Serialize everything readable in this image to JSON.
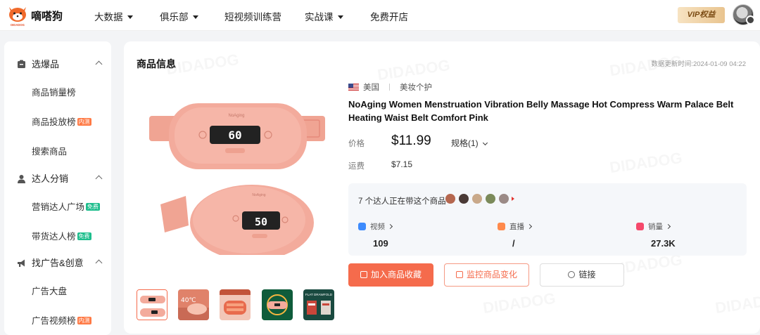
{
  "brand": {
    "name": "嘀嗒狗",
    "logo_text": "DIDADOG"
  },
  "nav": [
    {
      "label": "大数据",
      "dropdown": true
    },
    {
      "label": "俱乐部",
      "dropdown": true
    },
    {
      "label": "短视频训练营",
      "dropdown": false
    },
    {
      "label": "实战课",
      "dropdown": true
    },
    {
      "label": "免费开店",
      "dropdown": false
    }
  ],
  "vip_label": "VIP权益",
  "sidebar": {
    "groups": [
      {
        "label": "选爆品",
        "icon": "box-icon",
        "items": [
          {
            "label": "商品销量榜",
            "tag": ""
          },
          {
            "label": "商品投放榜",
            "tag": "内测"
          },
          {
            "label": "搜索商品",
            "tag": ""
          }
        ]
      },
      {
        "label": "达人分销",
        "icon": "user-icon",
        "items": [
          {
            "label": "营销达人广场",
            "tag": "免费"
          },
          {
            "label": "带货达人榜",
            "tag": "免费"
          }
        ]
      },
      {
        "label": "找广告&创意",
        "icon": "megaphone-icon",
        "items": [
          {
            "label": "广告大盘",
            "tag": ""
          },
          {
            "label": "广告视频榜",
            "tag": "内测"
          }
        ]
      }
    ]
  },
  "product": {
    "section_title": "商品信息",
    "update_time": "数据更新时间:2024-01-09 04:22",
    "country": "美国",
    "category": "美妆个护",
    "title": "NoAging Women Menstruation Vibration Belly Massage Hot Compress Warm Palace Belt Heating Waist Belt Comfort Pink",
    "price_label": "价格",
    "price": "$11.99",
    "spec_label": "规格(1)",
    "shipping_label": "运费",
    "shipping": "$7.15",
    "display_top": "60",
    "display_bottom": "50",
    "thumb_text_2": "40℃",
    "thumb_text_5": "FLAT DRAWFOLD"
  },
  "stats": {
    "influencer_text": "7 个达人正在带这个商品",
    "video_label": "视频",
    "video_value": "109",
    "live_label": "直播",
    "live_value": "/",
    "sales_label": "销量",
    "sales_value": "27.3K"
  },
  "buttons": {
    "favorite": "加入商品收藏",
    "monitor": "监控商品变化",
    "link": "链接"
  },
  "colors": {
    "accent": "#f56b4c",
    "belt": "#f2a393"
  },
  "watermark": "DIDADOG"
}
